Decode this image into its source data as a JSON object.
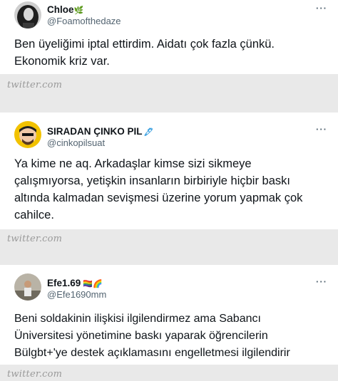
{
  "watermark": "twitter.com",
  "more_glyph": "···",
  "tweets": [
    {
      "name": "Chloe",
      "name_emoji": "🌿",
      "handle": "@Foamofthedaze",
      "lines": [
        "Ben üyeliğimi iptal ettirdim. Aidatı çok fazla çünkü.",
        "Ekonomik kriz var."
      ]
    },
    {
      "name": "SIRADAN ÇINKO PIL",
      "name_emoji": "🖋",
      "handle": "@cinkopilsuat",
      "lines": [
        "Ya kime ne aq. Arkadaşlar kimse sizi sikmeye",
        "çalışmıyorsa, yetişkin insanların birbiriyle hiçbir baskı",
        "altında kalmadan sevişmesi üzerine yorum yapmak çok",
        "cahilce."
      ]
    },
    {
      "name": "Efe1.69",
      "name_emoji": "🏳️‍🌈🌈",
      "handle": "@Efe1690mm",
      "lines": [
        "Beni soldakinin ilişkisi ilgilendirmez ama  Sabancı",
        "Üniversitesi yönetimine baskı yaparak öğrencilerin",
        "Bülgbt+'ye destek açıklamasını engelletmesi ilgilendirir"
      ]
    }
  ]
}
